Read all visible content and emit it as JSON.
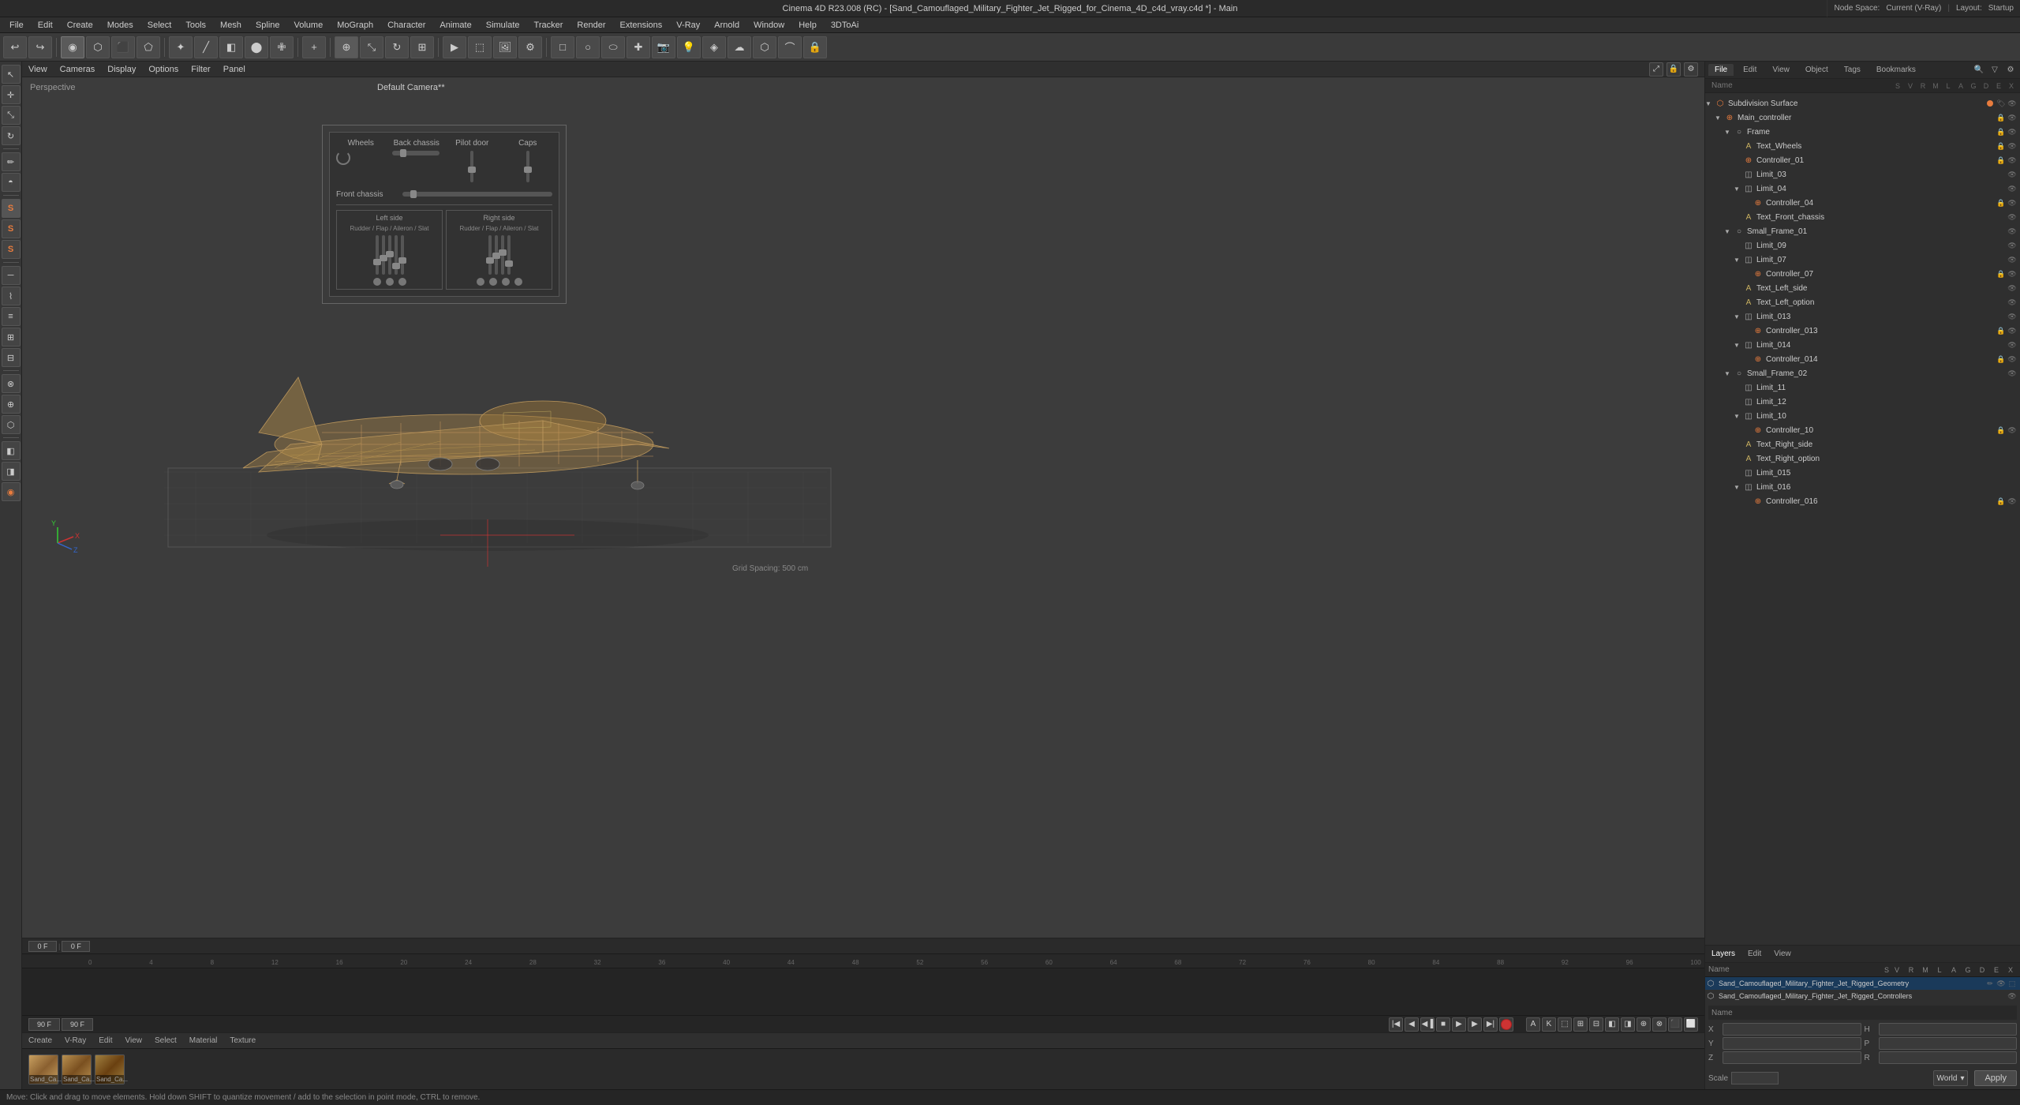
{
  "titleBar": {
    "title": "Cinema 4D R23.008 (RC) - [Sand_Camouflaged_Military_Fighter_Jet_Rigged_for_Cinema_4D_c4d_vray.c4d *] - Main"
  },
  "menuBar": {
    "items": [
      "File",
      "Edit",
      "Create",
      "Modes",
      "Select",
      "Tools",
      "Mesh",
      "Spline",
      "Volume",
      "MoGraph",
      "Character",
      "Animate",
      "Simulate",
      "Tracker",
      "Render",
      "Extensions",
      "V-Ray",
      "Arnold",
      "Window",
      "Help",
      "3DToAi"
    ]
  },
  "viewport": {
    "cameraLabel": "Default Camera**",
    "perspLabel": "Perspective",
    "gridSpacing": "Grid Spacing: 500 cm",
    "viewMenuItems": [
      "View",
      "Cameras",
      "Display",
      "Options",
      "Filter",
      "Panel"
    ]
  },
  "rigPanel": {
    "title": "Default Camera**",
    "sections": {
      "wheels": "Wheels",
      "backChassis": "Back chassis",
      "pilotDoor": "Pilot door",
      "caps": "Caps",
      "frontChassis": "Front chassis",
      "leftSide": "Left side",
      "rightSide": "Right side",
      "rudderFlap": "Rudder / Flap / Aileron / Slat"
    }
  },
  "rightPanel": {
    "tabs": [
      "Node Space:",
      "Current (V-Ray)",
      "Layout:",
      "Startup"
    ],
    "topTabs": [
      "File",
      "Edit",
      "View",
      "Object",
      "Tags",
      "Bookmarks"
    ],
    "treeHeader": {
      "nameCol": "Name",
      "cols": [
        "S",
        "V",
        "R",
        "M",
        "L",
        "A",
        "G",
        "D",
        "E",
        "X"
      ]
    },
    "treeItems": [
      {
        "name": "Subdivision Surface",
        "level": 0,
        "type": "obj",
        "color": "orange",
        "selected": false
      },
      {
        "name": "Main_controller",
        "level": 1,
        "type": "ctrl",
        "color": "orange",
        "selected": false
      },
      {
        "name": "Frame",
        "level": 2,
        "type": "null",
        "color": "orange",
        "selected": false
      },
      {
        "name": "Text_Wheels",
        "level": 3,
        "type": "text",
        "color": "orange",
        "selected": false
      },
      {
        "name": "Controller_01",
        "level": 3,
        "type": "ctrl",
        "color": "orange",
        "selected": false
      },
      {
        "name": "Limit_03",
        "level": 3,
        "type": "limit",
        "color": "orange",
        "selected": false
      },
      {
        "name": "Limit_04",
        "level": 3,
        "type": "limit",
        "color": "orange",
        "selected": false
      },
      {
        "name": "Controller_04",
        "level": 4,
        "type": "ctrl",
        "color": "orange",
        "selected": false
      },
      {
        "name": "Text_Front_chassis",
        "level": 3,
        "type": "text",
        "color": "orange",
        "selected": false
      },
      {
        "name": "Small_Frame_01",
        "level": 2,
        "type": "null",
        "color": "orange",
        "selected": false
      },
      {
        "name": "Limit_09",
        "level": 3,
        "type": "limit",
        "color": "orange",
        "selected": false
      },
      {
        "name": "Limit_07",
        "level": 3,
        "type": "limit",
        "color": "orange",
        "selected": false
      },
      {
        "name": "Controller_07",
        "level": 4,
        "type": "ctrl",
        "color": "orange",
        "selected": false
      },
      {
        "name": "Text_Left_side",
        "level": 3,
        "type": "text",
        "color": "orange",
        "selected": false
      },
      {
        "name": "Text_Left_option",
        "level": 3,
        "type": "text",
        "color": "orange",
        "selected": false
      },
      {
        "name": "Limit_013",
        "level": 3,
        "type": "limit",
        "color": "orange",
        "selected": false
      },
      {
        "name": "Controller_013",
        "level": 4,
        "type": "ctrl",
        "color": "orange",
        "selected": false
      },
      {
        "name": "Limit_014",
        "level": 3,
        "type": "limit",
        "color": "orange",
        "selected": false
      },
      {
        "name": "Controller_014",
        "level": 4,
        "type": "ctrl",
        "color": "orange",
        "selected": false
      },
      {
        "name": "Small_Frame_02",
        "level": 2,
        "type": "null",
        "color": "orange",
        "selected": false
      },
      {
        "name": "Limit_11",
        "level": 3,
        "type": "limit",
        "color": "orange",
        "selected": false
      },
      {
        "name": "Limit_12",
        "level": 3,
        "type": "limit",
        "color": "orange",
        "selected": false
      },
      {
        "name": "Limit_10",
        "level": 3,
        "type": "limit",
        "color": "orange",
        "selected": false
      },
      {
        "name": "Controller_10",
        "level": 4,
        "type": "ctrl",
        "color": "orange",
        "selected": false
      },
      {
        "name": "Text_Right_side",
        "level": 3,
        "type": "text",
        "color": "orange",
        "selected": false
      },
      {
        "name": "Text_Right_option",
        "level": 3,
        "type": "text",
        "color": "orange",
        "selected": false
      },
      {
        "name": "Limit_015",
        "level": 3,
        "type": "limit",
        "color": "orange",
        "selected": false
      },
      {
        "name": "Limit_016",
        "level": 3,
        "type": "limit",
        "color": "orange",
        "selected": false
      },
      {
        "name": "Controller_016",
        "level": 4,
        "type": "ctrl",
        "color": "orange",
        "selected": false
      }
    ],
    "layersTabs": [
      "Layers",
      "Edit",
      "View"
    ],
    "objectsRows": [
      {
        "name": "Sand_Camouflaged_Military_Fighter_Jet_Rigged_Geometry",
        "selected": true
      },
      {
        "name": "Sand_Camouflaged_Military_Fighter_Jet_Rigged_Controllers",
        "selected": false
      }
    ]
  },
  "properties": {
    "header": "Name",
    "xyzLabels": [
      "X",
      "Y",
      "Z"
    ],
    "hprLabel": [
      "H",
      "P",
      "R"
    ],
    "scaleLabel": "Scale",
    "applyLabel": "Apply",
    "worldLabel": "World",
    "fields": {
      "x": "",
      "y": "",
      "z": "",
      "h": "",
      "p": "",
      "r": ""
    }
  },
  "timeline": {
    "frameStart": "0",
    "frameEnd": "90 F",
    "currentFrame": "0 F",
    "currentTime": "90 F",
    "markers": [
      "0",
      "4",
      "8",
      "12",
      "16",
      "20",
      "24",
      "28",
      "32",
      "36",
      "40",
      "44",
      "48",
      "52",
      "56",
      "60",
      "64",
      "68",
      "72",
      "76",
      "80",
      "84",
      "88",
      "92",
      "96",
      "100"
    ]
  },
  "materials": [
    {
      "label": "Sand_Ca...",
      "type": "vray"
    },
    {
      "label": "Sand_Ca...",
      "type": "vray"
    },
    {
      "label": "Sand_Ca...",
      "type": "vray"
    }
  ],
  "bottomTabs": {
    "items": [
      "Create",
      "V-Ray",
      "Edit",
      "View",
      "Select",
      "Material",
      "Texture"
    ]
  },
  "statusBar": {
    "text": "Move: Click and drag to move elements. Hold down SHIFT to quantize movement / add to the selection in point mode, CTRL to remove."
  }
}
